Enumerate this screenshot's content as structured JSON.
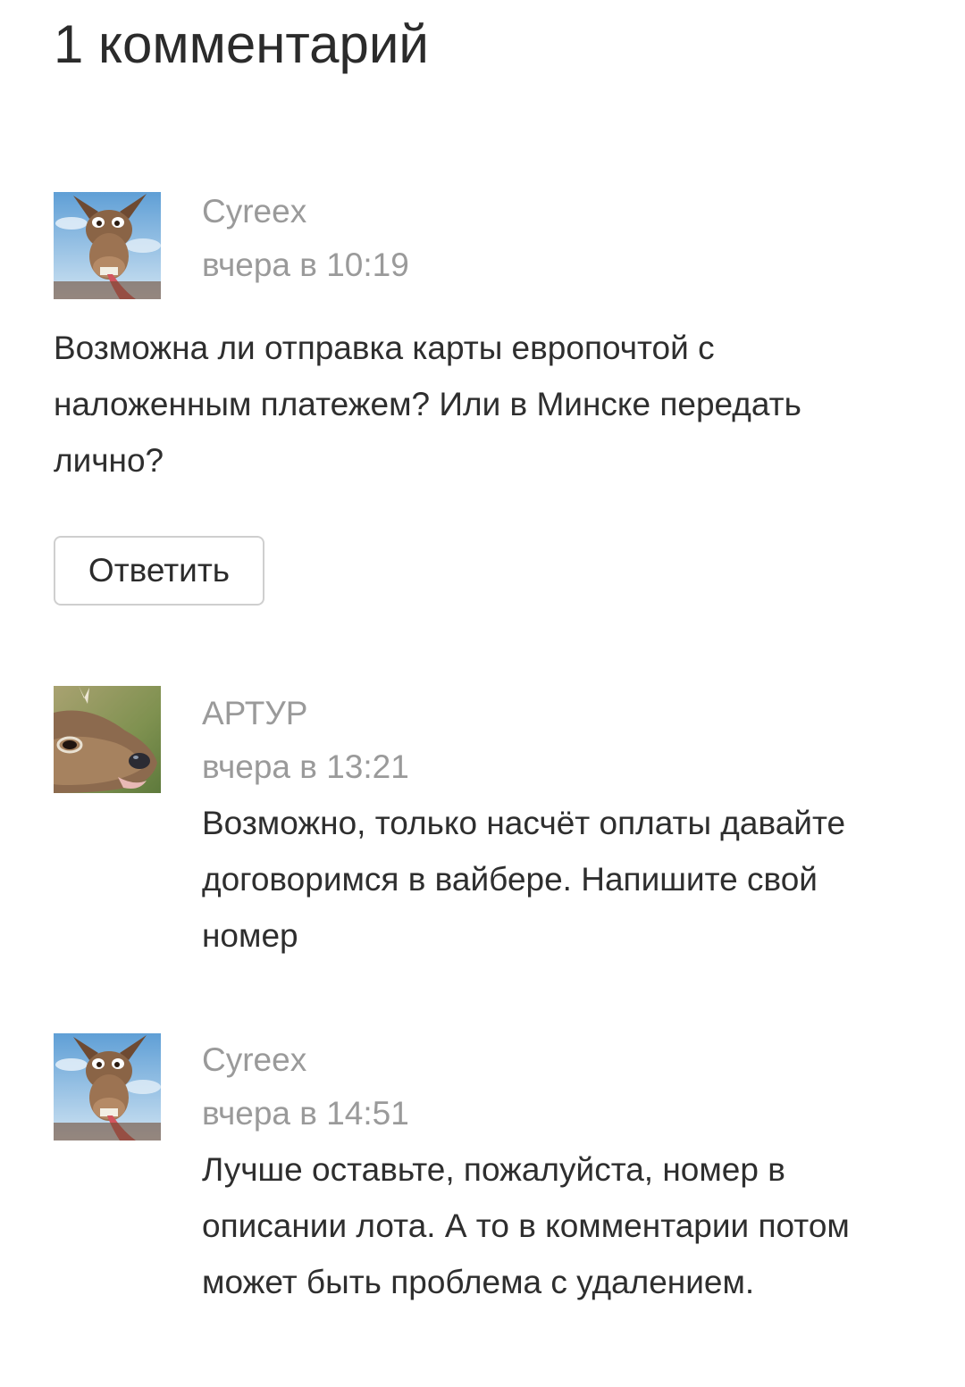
{
  "comments_header": {
    "title": "1 комментарий"
  },
  "comments": [
    {
      "author": "Cyreex",
      "time": "вчера в 10:19",
      "text": "Возможна ли отправка карты европочтой с наложенным платежем? Или в Минске передать лично?",
      "avatar_icon": "donkey-avatar-icon",
      "reply_label": "Ответить"
    },
    {
      "author": "АРТУР",
      "time": "вчера в 13:21",
      "text": "Возможно, только насчёт оплаты давайте договоримся в вайбере. Напишите свой номер",
      "avatar_icon": "deer-avatar-icon"
    },
    {
      "author": "Cyreex",
      "time": "вчера в 14:51",
      "text": "Лучше оставьте, пожалуйста, номер в описании лота. А то в комментарии потом может быть проблема с удалением.",
      "avatar_icon": "donkey-avatar-icon"
    }
  ]
}
